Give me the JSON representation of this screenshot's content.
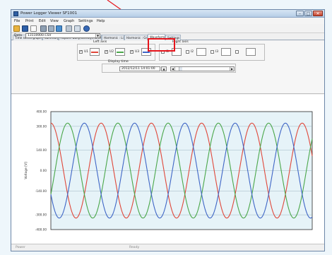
{
  "window": {
    "title": "Power Logger Viewer SF1001",
    "controls": {
      "minimize": "–",
      "maximize": "□",
      "close": "✕"
    }
  },
  "menu": [
    "File",
    "Print",
    "Edit",
    "View",
    "Graph",
    "Settings",
    "Help"
  ],
  "toolbar": {
    "buttons": [
      "open-folder-icon",
      "save-icon",
      "new-document-icon",
      "print-icon",
      "print-preview-icon",
      "copy-icon",
      "settings-icon",
      "chart-icon",
      "help-icon"
    ]
  },
  "tabs": [
    "Time series graph",
    "Summary",
    "Report: Daily/Weekly/Monthly",
    "Harmonic : List",
    "Harmonic : Graph",
    "Waveform",
    "Settings"
  ],
  "active_tab": "Waveform",
  "panel": {
    "data_label": "Data",
    "data_value": "13110000.CSV",
    "left_axis_label": "Left axis",
    "right_axis_label": "Right axis",
    "left_channels": [
      "U1",
      "U2",
      "U3"
    ],
    "right_channels": [
      "I1",
      "I2",
      "I3",
      ""
    ],
    "display_time_label": "Display time",
    "display_time_value": "2012/12/11  14:01:00"
  },
  "colors": {
    "u1": "#e0473a",
    "u2": "#4aa74a",
    "u3": "#3f66c6",
    "highlight": "#e6141b",
    "plot_bg": "#e6f3f8"
  },
  "chart_data": {
    "type": "line",
    "ylabel": "Voltage [V]",
    "y_ticks": [
      "400.00",
      "300.00",
      "140.00",
      "0.00",
      "-140.00",
      "-300.00",
      "-400.00"
    ],
    "ylim": [
      -400,
      400
    ],
    "x_cycles": 5.2,
    "series": [
      {
        "name": "U1",
        "amplitude": 322,
        "phase_deg": 0
      },
      {
        "name": "U2",
        "amplitude": 322,
        "phase_deg": -120
      },
      {
        "name": "U3",
        "amplitude": 322,
        "phase_deg": 120
      }
    ]
  },
  "status": {
    "left": "Power",
    "center": "Ready"
  }
}
